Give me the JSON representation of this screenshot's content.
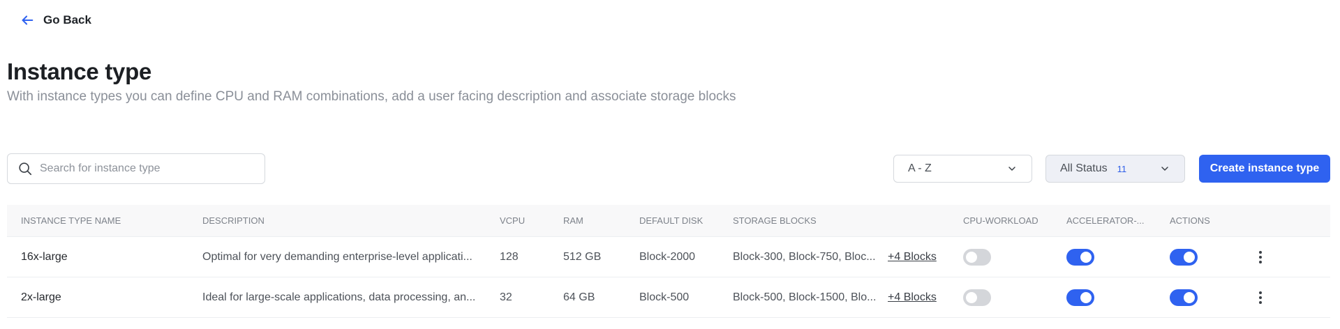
{
  "nav": {
    "go_back_label": "Go Back"
  },
  "header": {
    "title": "Instance type",
    "subtitle": "With instance types you can define CPU and RAM combinations, add a user facing description and associate storage blocks"
  },
  "toolbar": {
    "search_placeholder": "Search for instance type",
    "sort_value": "A - Z",
    "status_label": "All Status",
    "status_count": "11",
    "create_label": "Create instance type"
  },
  "table": {
    "columns": [
      "INSTANCE TYPE NAME",
      "DESCRIPTION",
      "VCPU",
      "RAM",
      "DEFAULT DISK",
      "STORAGE BLOCKS",
      "CPU-WORKLOAD",
      "ACCELERATOR-...",
      "ACTIONS"
    ],
    "rows": [
      {
        "name": "16x-large",
        "description": "Optimal for very demanding enterprise-level applicati...",
        "vcpu": "128",
        "ram": "512 GB",
        "default_disk": "Block-2000",
        "storage_blocks": "Block-300, Block-750, Bloc...",
        "more_blocks": "+4 Blocks",
        "cpu_workload": false,
        "accelerator": true,
        "actions_enabled": true
      },
      {
        "name": "2x-large",
        "description": "Ideal for large-scale applications, data processing, an...",
        "vcpu": "32",
        "ram": "64 GB",
        "default_disk": "Block-500",
        "storage_blocks": "Block-500, Block-1500, Blo...",
        "more_blocks": "+4 Blocks",
        "cpu_workload": false,
        "accelerator": true,
        "actions_enabled": true
      }
    ]
  },
  "colors": {
    "accent": "#2f62f0",
    "toggle_off": "#d4d6da",
    "subtitle": "#8a8f98"
  },
  "icons": {
    "back": "arrow-left-icon",
    "search": "search-icon",
    "dropdown": "chevron-down-icon",
    "row_menu": "kebab-menu-icon"
  }
}
